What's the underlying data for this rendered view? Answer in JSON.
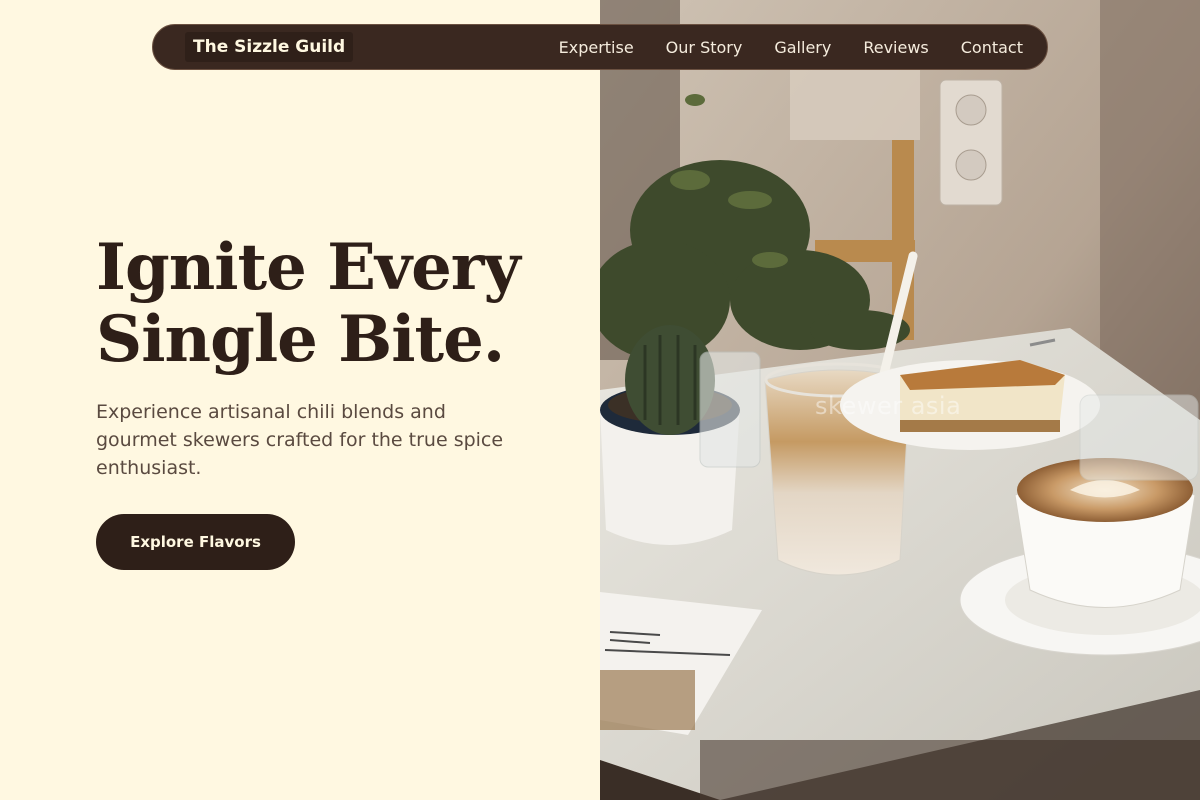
{
  "brand": {
    "name": "The Sizzle Guild"
  },
  "nav": {
    "items": [
      {
        "label": "Expertise"
      },
      {
        "label": "Our Story"
      },
      {
        "label": "Gallery"
      },
      {
        "label": "Reviews"
      },
      {
        "label": "Contact"
      }
    ]
  },
  "hero": {
    "title": "Ignite Every Single Bite.",
    "subtitle": "Experience artisanal chili blends and gourmet skewers crafted for the true spice enthusiast.",
    "cta_label": "Explore Flavors"
  },
  "image": {
    "watermark": "skewer asia"
  },
  "colors": {
    "background": "#FFF8E1",
    "primary": "#2E1F18",
    "nav_bg": "#3A2820",
    "text_muted": "#5A4A40"
  }
}
